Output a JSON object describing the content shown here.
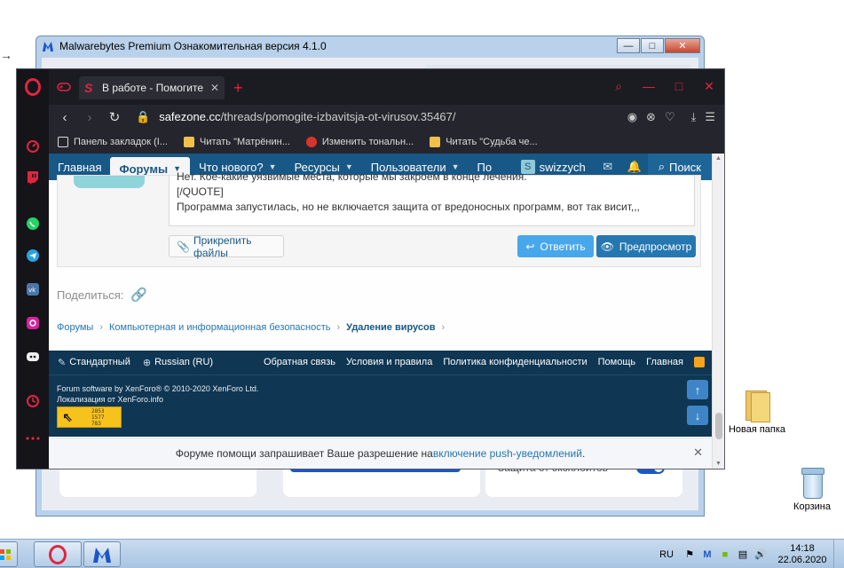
{
  "malwarebytes": {
    "title": "Malwarebytes Premium Ознакомительная версия  4.1.0",
    "minimize": "—",
    "maximize": "□",
    "close": "✕",
    "exploit_label": "Защита от эксплойтов"
  },
  "desktop": {
    "folder_label": "Новая папка",
    "bin_label": "Корзина",
    "edge_arrow": "→"
  },
  "opera": {
    "tab_title": "В работе - Помогите изба",
    "tab_close": "✕",
    "new_tab": "+",
    "win_search": "⌕",
    "win_min": "—",
    "win_max": "□",
    "win_close": "✕",
    "url_host": "safezone.cc",
    "url_path": "/threads/pomogite-izbavitsja-ot-virusov.35467/",
    "bookmarks": [
      {
        "label": "Панель закладок (I...",
        "color": "#e8c25a"
      },
      {
        "label": "Читать \"Матрёнин...",
        "color": "#f0c04a"
      },
      {
        "label": "Изменить тональн...",
        "color": "#d9342b"
      },
      {
        "label": "Читать \"Судьба че...",
        "color": "#f0c04a"
      }
    ]
  },
  "forum": {
    "nav": {
      "home": "Главная",
      "forums": "Форумы",
      "whats_new": "Что нового?",
      "resources": "Ресурсы",
      "users": "Пользователи",
      "truncated": "По",
      "username": "swizzych",
      "avatar_letter": "S",
      "search": "Поиск"
    },
    "editor": {
      "line1": "Нет. Кое-какие уязвимые места, которые мы закроем в конце лечения.",
      "line2": "[/QUOTE]",
      "line3": "Программа запустилась, но не включается защита от вредоносных программ, вот так висит,,,"
    },
    "attach": "Прикрепить файлы",
    "reply": "Ответить",
    "preview": "Предпросмотр",
    "share": "Поделиться:",
    "breadcrumb": {
      "forums": "Форумы",
      "section": "Компьютерная и информационная безопасность",
      "current": "Удаление вирусов"
    },
    "footer": {
      "style": "Стандартный",
      "language": "Russian (RU)",
      "feedback": "Обратная связь",
      "terms": "Условия и правила",
      "privacy": "Политика конфиденциальности",
      "help": "Помощь",
      "home": "Главная",
      "copyright": "Forum software by XenForo® © 2010-2020 XenForo Ltd.",
      "localization": "Локализация от XenForo.info",
      "counter_1": "2853",
      "counter_2": "1577",
      "counter_3": "783"
    },
    "push": {
      "prefix": "Форуме помощи запрашивает Ваше разрешение на ",
      "link": "включение push-уведомлений",
      "suffix": "."
    }
  },
  "taskbar": {
    "lang": "RU",
    "time": "14:18",
    "date": "22.06.2020"
  }
}
